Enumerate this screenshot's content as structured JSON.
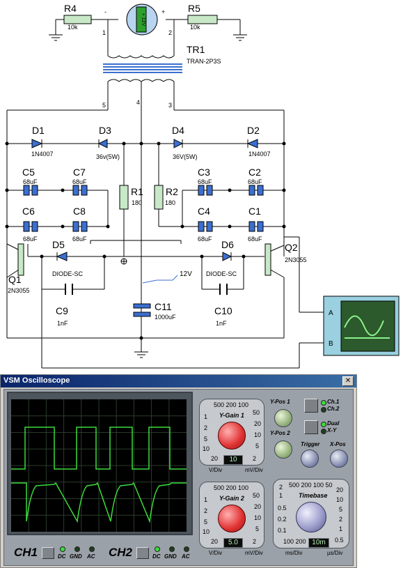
{
  "schematic": {
    "components": {
      "r4": {
        "ref": "R4",
        "value": "10k"
      },
      "r5": {
        "ref": "R5",
        "value": "10k"
      },
      "battery": {
        "label": "+ 12V"
      },
      "tr1": {
        "ref": "TR1",
        "value": "TRAN-2P3S"
      },
      "d1": {
        "ref": "D1",
        "value": "1N4007"
      },
      "d2": {
        "ref": "D2",
        "value": "1N4007"
      },
      "d3": {
        "ref": "D3",
        "value": "36v(5W)"
      },
      "d4": {
        "ref": "D4",
        "value": "36V(5W)"
      },
      "c5": {
        "ref": "C5",
        "value": "68uF"
      },
      "c6": {
        "ref": "C6",
        "value": "68uF"
      },
      "c7": {
        "ref": "C7",
        "value": "68uF"
      },
      "c8": {
        "ref": "C8",
        "value": "68uF"
      },
      "c1": {
        "ref": "C1",
        "value": "68uF"
      },
      "c2": {
        "ref": "C2",
        "value": "68uF"
      },
      "c3": {
        "ref": "C3",
        "value": "68uF"
      },
      "c4": {
        "ref": "C4",
        "value": "68uF"
      },
      "r1": {
        "ref": "R1",
        "value": "180"
      },
      "r2": {
        "ref": "R2",
        "value": "180"
      },
      "d5": {
        "ref": "D5",
        "value": "DIODE-SC"
      },
      "d6": {
        "ref": "D6",
        "value": "DIODE-SC"
      },
      "q1": {
        "ref": "Q1",
        "value": "2N3055"
      },
      "q2": {
        "ref": "Q2",
        "value": "2N3055"
      },
      "c9": {
        "ref": "C9",
        "value": "1nF"
      },
      "c10": {
        "ref": "C10",
        "value": "1nF"
      },
      "c11": {
        "ref": "C11",
        "value": "1000uF"
      },
      "supply": {
        "label": "12V"
      }
    },
    "pins": {
      "p_minus": "-",
      "p1": "1",
      "p2": "2",
      "p_plus": "+",
      "p5": "5",
      "p4": "4",
      "p3": "3"
    },
    "scope_channels": {
      "a": "A",
      "b": "B"
    }
  },
  "oscilloscope": {
    "title": "VSM Oscilloscope",
    "close_glyph": "✕",
    "ch1": {
      "label": "CH1",
      "dc": "DC",
      "gnd": "GND",
      "ac": "AC"
    },
    "ch2": {
      "label": "CH2",
      "dc": "DC",
      "gnd": "GND",
      "ac": "AC"
    },
    "ygain1": {
      "title": "Y-Gain 1",
      "top_scale": "500 200 100",
      "left_scale": [
        "1",
        "2",
        "5",
        "10",
        "20"
      ],
      "right_scale": [
        "50",
        "20",
        "10",
        "5",
        "2"
      ],
      "value": "10",
      "unit_left": "V/Div",
      "unit_right": "mV/Div"
    },
    "ygain2": {
      "title": "Y-Gain 2",
      "top_scale": "500 200 100",
      "left_scale": [
        "1",
        "2",
        "5",
        "10",
        "20"
      ],
      "right_scale": [
        "50",
        "20",
        "10",
        "5",
        "2"
      ],
      "value": "5.0",
      "unit_left": "V/Div",
      "unit_right": "mV/Div"
    },
    "ypos1": "Y-Pos 1",
    "ypos2": "Y-Pos 2",
    "ch_select": {
      "ch1": "Ch.1",
      "ch2": "Ch.2",
      "dual": "Dual",
      "xy": "X-Y"
    },
    "trigger": "Trigger",
    "xpos": "X-Pos",
    "timebase": {
      "title": "Timebase",
      "top_scale": "500 200 100 50",
      "left_scale": [
        "2",
        "1",
        "0.5",
        "0.2",
        "0.1"
      ],
      "right_scale": [
        "20",
        "10",
        "5",
        "2",
        "1",
        "0.5"
      ],
      "bottom_scale": "100 200",
      "value": "10m",
      "unit_left": "ms/Div",
      "unit_right": "µs/Div"
    },
    "colors": {
      "trace": "#3cdc3c",
      "grid": "#2c3c2c",
      "screen": "#000000"
    }
  }
}
